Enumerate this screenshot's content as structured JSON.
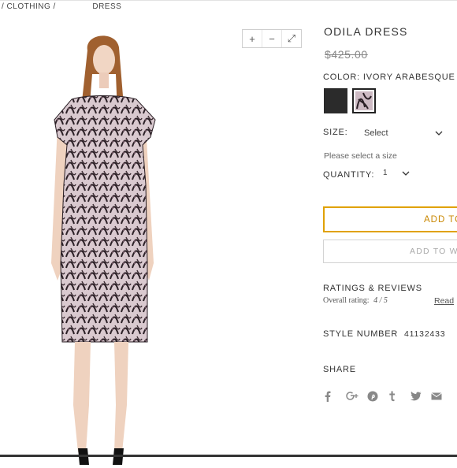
{
  "breadcrumb": {
    "segment_1": "/ CLOTHING /",
    "segment_2": "DRESS"
  },
  "zoom": {
    "zoom_in": "+",
    "zoom_out": "−",
    "fullscreen": "⤢"
  },
  "product": {
    "name": "ODILA DRESS",
    "price": "$425.00",
    "color_label": "COLOR:",
    "color_value": "IVORY ARABESQUE C",
    "swatches": [
      "black",
      "ivory-arabesque"
    ],
    "size_label": "SIZE:",
    "size_select": "Select",
    "size_hint": "Please select a size",
    "quantity_label": "QUANTITY:",
    "quantity_value": "1",
    "add_to_bag": "ADD TO",
    "add_to_wishlist": "ADD TO W",
    "style_label": "STYLE NUMBER",
    "style_number": "41132433"
  },
  "reviews": {
    "title": "RATINGS & REVIEWS",
    "overall_label": "Overall rating:",
    "overall_value": "4 / 5",
    "read_link": "Read"
  },
  "share": {
    "label": "SHARE",
    "icons": [
      "facebook-icon",
      "google-plus-icon",
      "pinterest-icon",
      "tumblr-icon",
      "twitter-icon",
      "email-icon"
    ]
  },
  "colors": {
    "accent": "#e0a100",
    "accent_text": "#c98700",
    "text": "#333333",
    "muted": "#888888"
  }
}
